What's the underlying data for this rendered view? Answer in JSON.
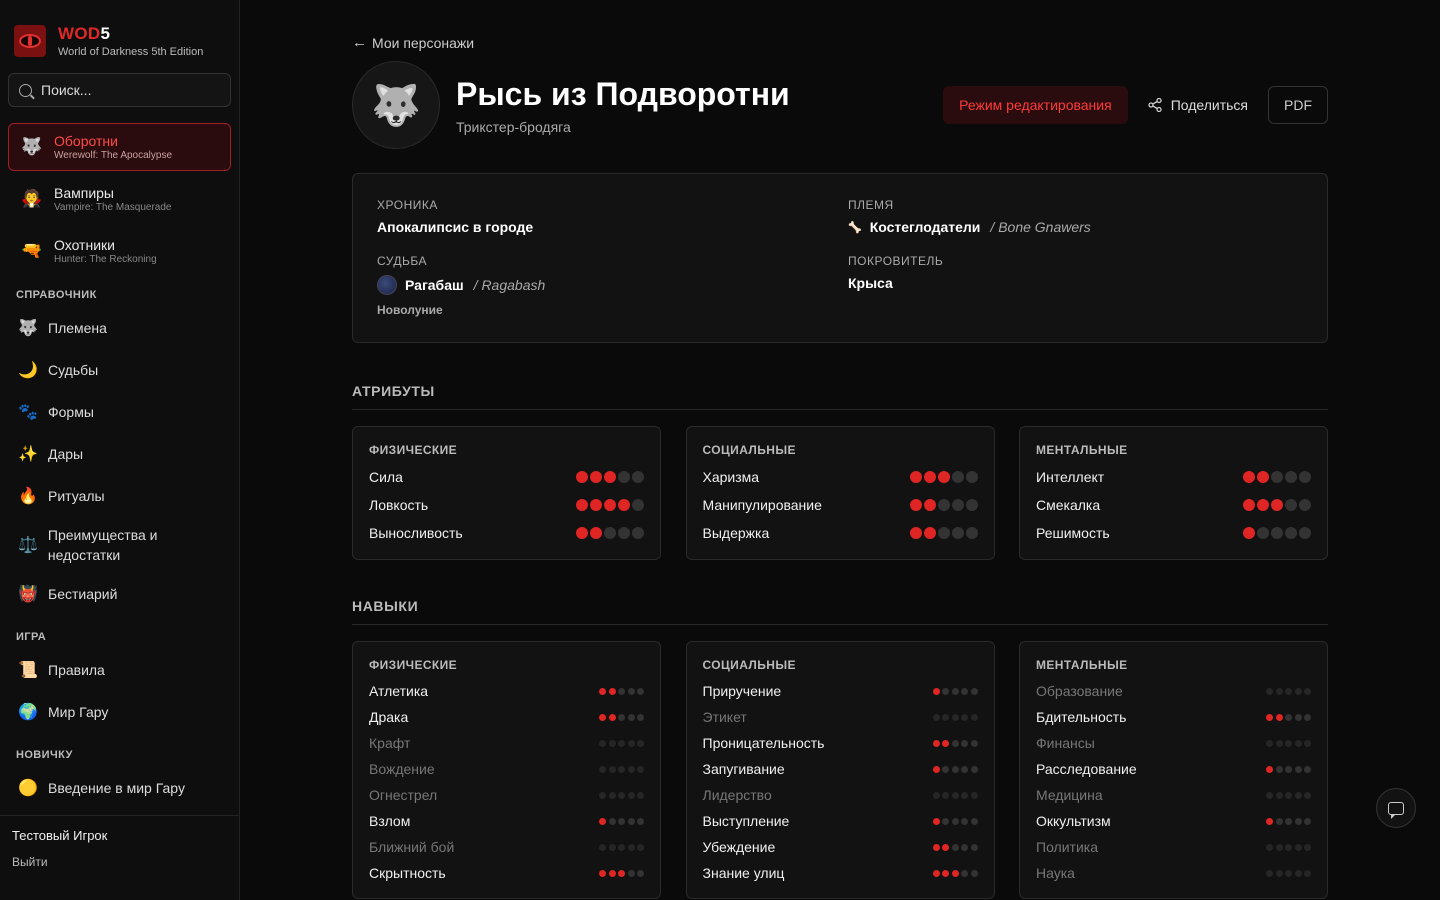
{
  "brand": {
    "name": "WOD",
    "num": "5",
    "subtitle": "World of Darkness 5th Edition"
  },
  "search": {
    "placeholder": "Поиск..."
  },
  "games": [
    {
      "title": "Оборотни",
      "subtitle": "Werewolf: The Apocalypse",
      "icon": "🐺",
      "active": true
    },
    {
      "title": "Вампиры",
      "subtitle": "Vampire: The Masquerade",
      "icon": "🧛",
      "active": false
    },
    {
      "title": "Охотники",
      "subtitle": "Hunter: The Reckoning",
      "icon": "🔫",
      "active": false
    }
  ],
  "sections": {
    "reference": {
      "title": "СПРАВОЧНИК",
      "items": [
        {
          "label": "Племена",
          "icon": "🐺"
        },
        {
          "label": "Судьбы",
          "icon": "🌙"
        },
        {
          "label": "Формы",
          "icon": "🐾"
        },
        {
          "label": "Дары",
          "icon": "✨"
        },
        {
          "label": "Ритуалы",
          "icon": "🔥"
        },
        {
          "label": "Преимущества и недостатки",
          "icon": "⚖️"
        },
        {
          "label": "Бестиарий",
          "icon": "👹"
        }
      ]
    },
    "game": {
      "title": "ИГРА",
      "items": [
        {
          "label": "Правила",
          "icon": "📜"
        },
        {
          "label": "Мир Гару",
          "icon": "🌍"
        }
      ]
    },
    "newbie": {
      "title": "НОВИЧКУ",
      "items": [
        {
          "label": "Введение в мир Гару",
          "icon": "🟡"
        }
      ]
    }
  },
  "user": {
    "name": "Тестовый Игрок",
    "logout": "Выйти"
  },
  "back": {
    "arrow": "←",
    "label": "Мои персонажи"
  },
  "character": {
    "name": "Рысь из Подворотни",
    "concept": "Трикстер-бродяга",
    "avatar_icon": "🐺"
  },
  "actions": {
    "edit": "Режим редактирования",
    "share": "Поделиться",
    "pdf": "PDF"
  },
  "info": {
    "chronicle": {
      "label": "ХРОНИКА",
      "value": "Апокалипсис в городе"
    },
    "tribe": {
      "label": "ПЛЕМЯ",
      "value": "Костеглодатели",
      "alt": "/ Bone Gnawers",
      "icon": "🦴"
    },
    "auspice": {
      "label": "СУДЬБА",
      "value": "Рагабаш",
      "alt": "/ Ragabash",
      "moon": "Новолуние"
    },
    "patron": {
      "label": "ПОКРОВИТЕЛЬ",
      "value": "Крыса"
    }
  },
  "attributes": {
    "title": "АТРИБУТЫ",
    "max": 5,
    "groups": [
      {
        "title": "ФИЗИЧЕСКИЕ",
        "items": [
          {
            "name": "Сила",
            "value": 3
          },
          {
            "name": "Ловкость",
            "value": 4
          },
          {
            "name": "Выносливость",
            "value": 2
          }
        ]
      },
      {
        "title": "СОЦИАЛЬНЫЕ",
        "items": [
          {
            "name": "Харизма",
            "value": 3
          },
          {
            "name": "Манипулирование",
            "value": 2
          },
          {
            "name": "Выдержка",
            "value": 2
          }
        ]
      },
      {
        "title": "МЕНТАЛЬНЫЕ",
        "items": [
          {
            "name": "Интеллект",
            "value": 2
          },
          {
            "name": "Смекалка",
            "value": 3
          },
          {
            "name": "Решимость",
            "value": 1
          }
        ]
      }
    ]
  },
  "skills": {
    "title": "НАВЫКИ",
    "max": 5,
    "groups": [
      {
        "title": "ФИЗИЧЕСКИЕ",
        "items": [
          {
            "name": "Атлетика",
            "value": 2
          },
          {
            "name": "Драка",
            "value": 2
          },
          {
            "name": "Крафт",
            "value": 0
          },
          {
            "name": "Вождение",
            "value": 0
          },
          {
            "name": "Огнестрел",
            "value": 0
          },
          {
            "name": "Взлом",
            "value": 1
          },
          {
            "name": "Ближний бой",
            "value": 0
          },
          {
            "name": "Скрытность",
            "value": 3
          }
        ]
      },
      {
        "title": "СОЦИАЛЬНЫЕ",
        "items": [
          {
            "name": "Приручение",
            "value": 1
          },
          {
            "name": "Этикет",
            "value": 0
          },
          {
            "name": "Проницательность",
            "value": 2
          },
          {
            "name": "Запугивание",
            "value": 1
          },
          {
            "name": "Лидерство",
            "value": 0
          },
          {
            "name": "Выступление",
            "value": 1
          },
          {
            "name": "Убеждение",
            "value": 2
          },
          {
            "name": "Знание улиц",
            "value": 3
          }
        ]
      },
      {
        "title": "МЕНТАЛЬНЫЕ",
        "items": [
          {
            "name": "Образование",
            "value": 0
          },
          {
            "name": "Бдительность",
            "value": 2
          },
          {
            "name": "Финансы",
            "value": 0
          },
          {
            "name": "Расследование",
            "value": 1
          },
          {
            "name": "Медицина",
            "value": 0
          },
          {
            "name": "Оккультизм",
            "value": 1
          },
          {
            "name": "Политика",
            "value": 0
          },
          {
            "name": "Наука",
            "value": 0
          }
        ]
      }
    ]
  },
  "colors": {
    "accent": "#e02525",
    "bg": "#0a0a0a",
    "card": "#121212"
  }
}
